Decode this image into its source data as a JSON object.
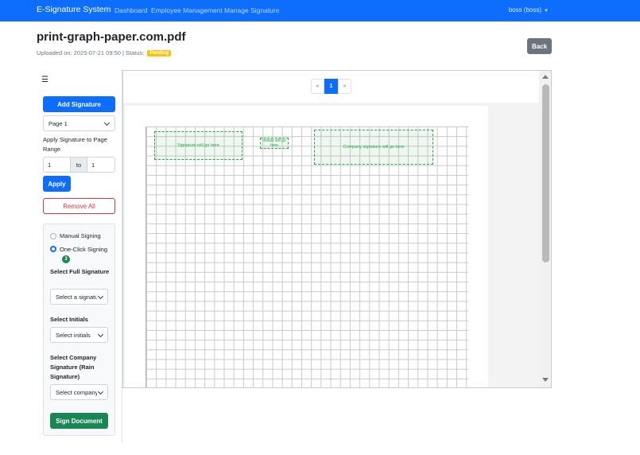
{
  "navbar": {
    "brand": "E-Signature System",
    "links": [
      "Dashboard",
      "Employee Management",
      "Manage Signature"
    ],
    "user": "boss (boss)"
  },
  "document": {
    "title": "print-graph-paper.com.pdf",
    "uploaded_label": "Uploaded on: 2025-07-21 09:50 | Status:",
    "status": "Pending",
    "back_label": "Back"
  },
  "sidebar": {
    "menu_icon": "hamburger-icon",
    "add_signature_label": "Add Signature",
    "page_select_value": "Page 1",
    "range_label": "Apply Signature to Page Range",
    "range_from": "1",
    "range_to_label": "to",
    "range_to": "1",
    "apply_label": "Apply",
    "remove_all_label": "Remove All"
  },
  "signing": {
    "manual_label": "Manual Signing",
    "oneclick_label": "One-Click Signing",
    "oneclick_count": "3",
    "selected_mode": "one-click",
    "full_sig_label": "Select Full Signature",
    "full_sig_placeholder": "Select a signature",
    "initials_label": "Select Initials",
    "initials_placeholder": "Select initials",
    "company_label": "Select Company Signature (Rain Signature)",
    "company_placeholder": "Select company",
    "sign_button_label": "Sign Document"
  },
  "viewer": {
    "pager_prev": "«",
    "pager_current": "1",
    "pager_next": "»",
    "placeholders": {
      "signature": "Signature will go here",
      "initials": "Initials will go here",
      "company": "Company signature will go here"
    }
  },
  "colors": {
    "primary": "#0d6efd",
    "success": "#198754",
    "danger": "#dc3545",
    "warning": "#ffc107",
    "secondary": "#6c757d"
  }
}
